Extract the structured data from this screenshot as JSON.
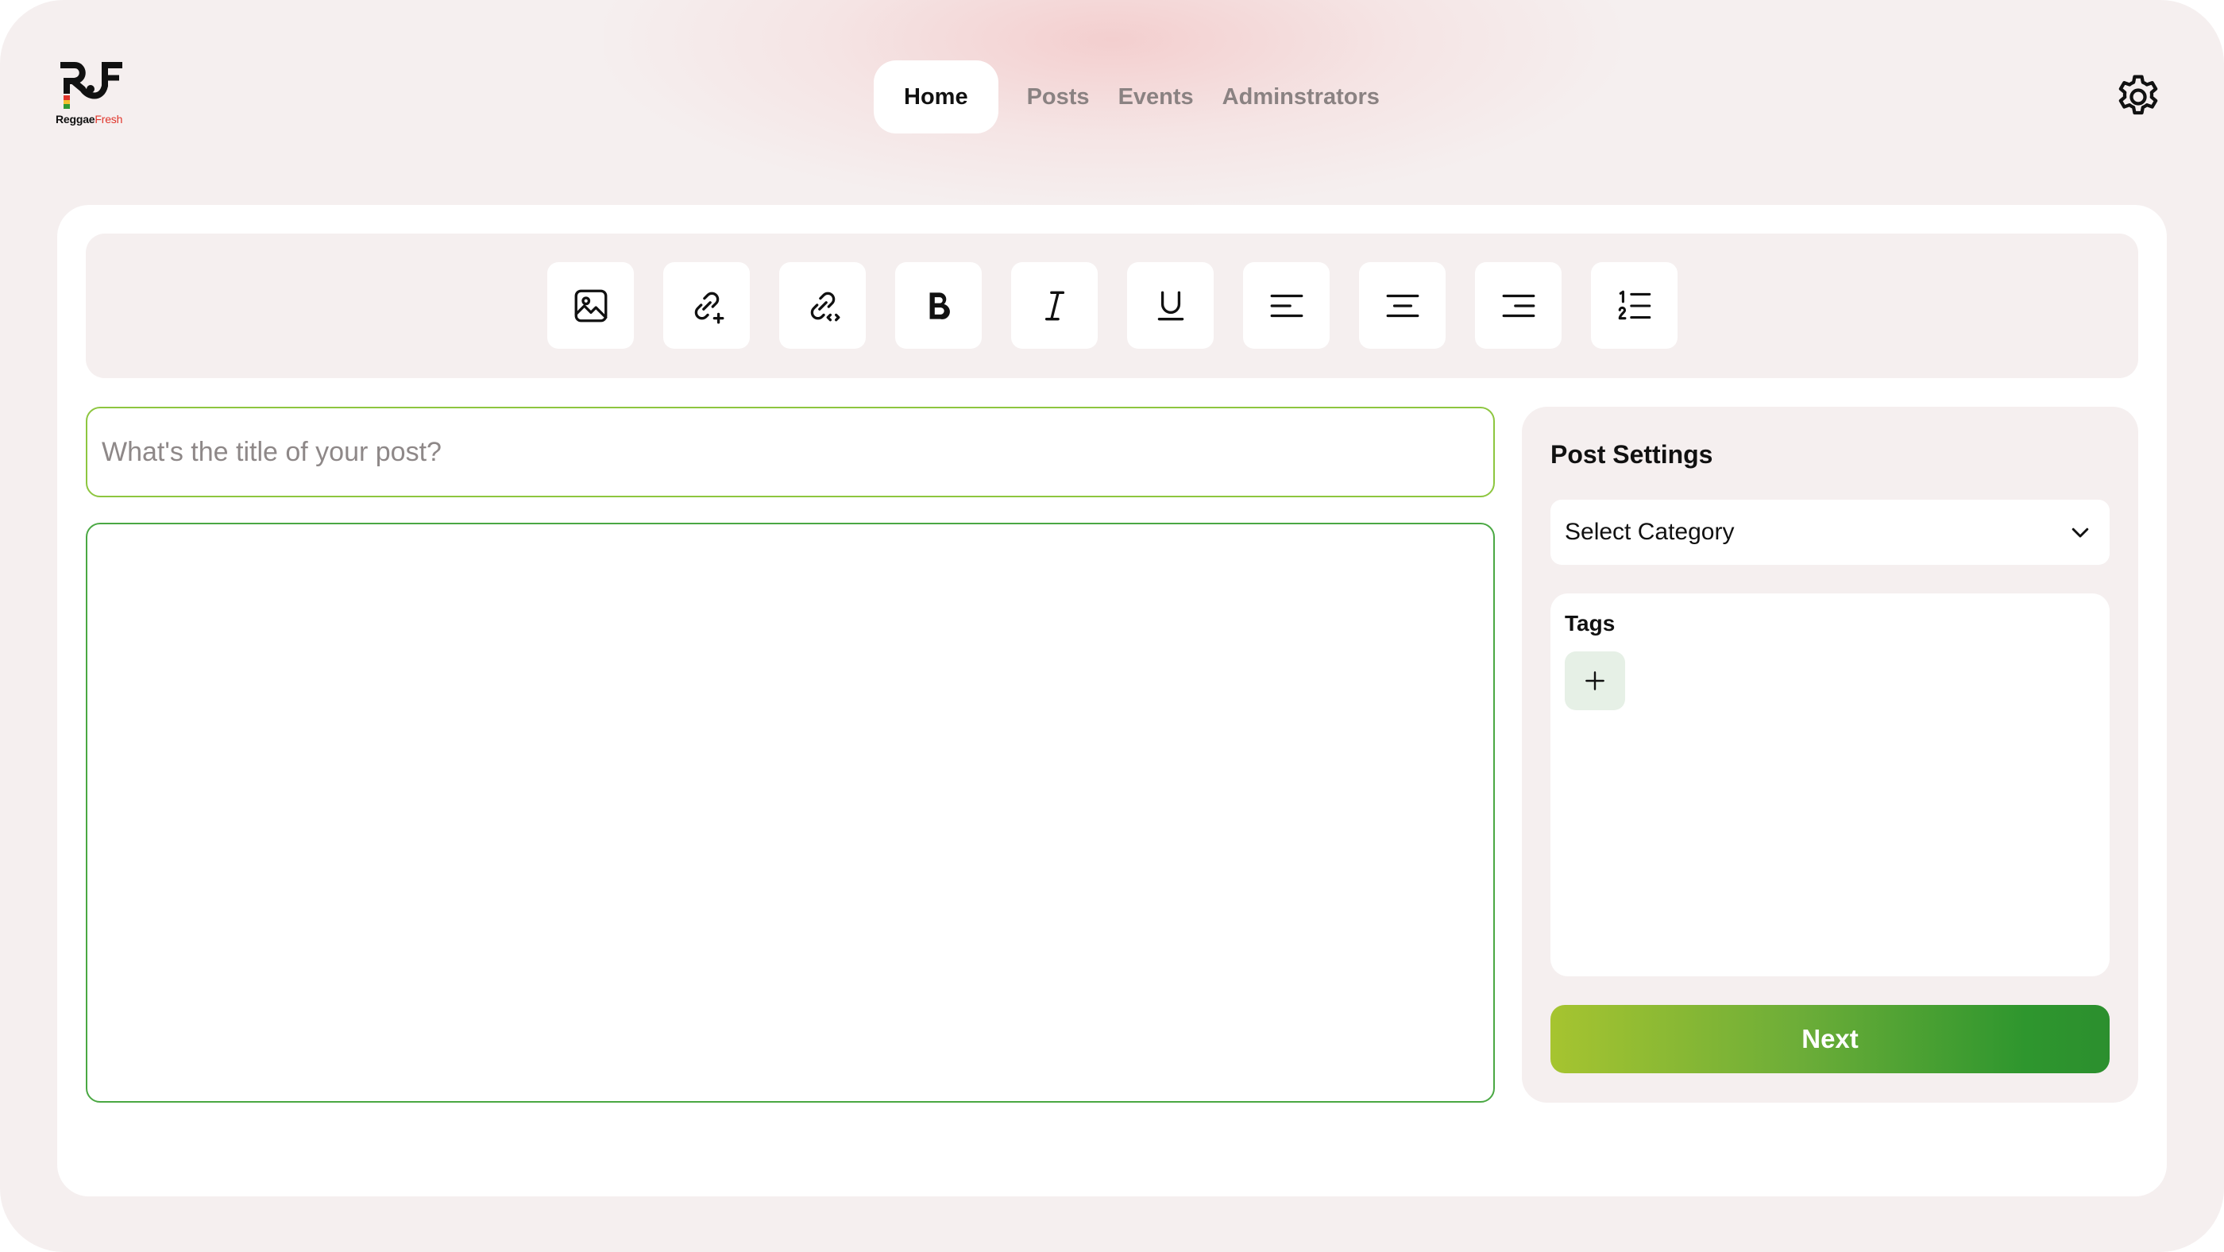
{
  "brand": {
    "logo_mark": "RF",
    "name_main": "Reggae",
    "name_accent": "Fresh",
    "accent_color": "#e0352b"
  },
  "nav": {
    "items": [
      {
        "label": "Home",
        "active": true
      },
      {
        "label": "Posts",
        "active": false
      },
      {
        "label": "Events",
        "active": false
      },
      {
        "label": "Adminstrators",
        "active": false
      }
    ]
  },
  "header": {
    "settings_icon": "gear-icon"
  },
  "toolbar": {
    "tools": [
      {
        "icon": "image-icon"
      },
      {
        "icon": "add-link-icon"
      },
      {
        "icon": "embed-link-icon"
      },
      {
        "icon": "bold-icon"
      },
      {
        "icon": "italic-icon"
      },
      {
        "icon": "underline-icon"
      },
      {
        "icon": "align-left-icon"
      },
      {
        "icon": "align-center-icon"
      },
      {
        "icon": "align-right-icon"
      },
      {
        "icon": "numbered-list-icon"
      }
    ]
  },
  "editor": {
    "title_placeholder": "What's the title of your post?",
    "title_value": "",
    "body_value": ""
  },
  "post_settings": {
    "title": "Post Settings",
    "category_select": {
      "value": "Select Category",
      "icon": "chevron-down-icon"
    },
    "tags": {
      "label": "Tags",
      "add_icon": "plus-icon"
    },
    "next_label": "Next"
  },
  "colors": {
    "title_border": "#8dc63f",
    "body_border": "#4aa843",
    "next_gradient_start": "#a6c430",
    "next_gradient_end": "#2c8f2e",
    "background": "#f5efef"
  }
}
